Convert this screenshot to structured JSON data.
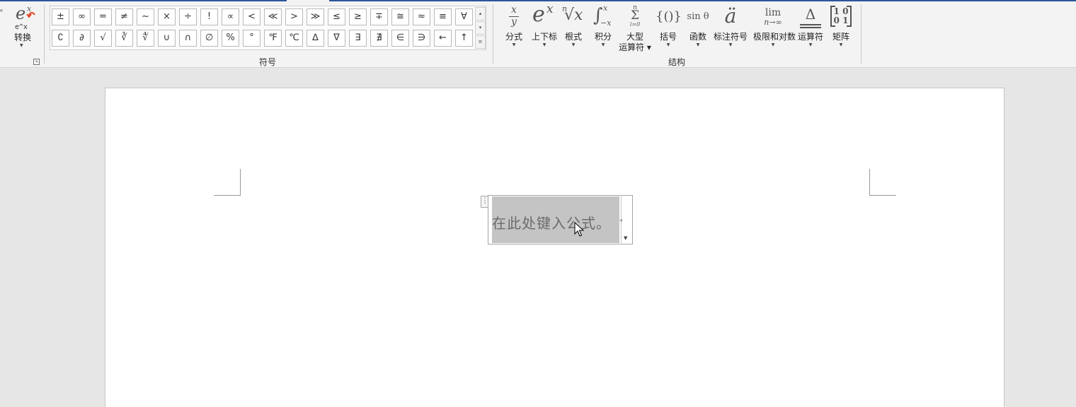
{
  "conversion": {
    "icon_name": "equation-convert-icon",
    "icon_top": "e",
    "icon_sup": "x",
    "icon_sub": "e^x",
    "label": "转换"
  },
  "symbols": {
    "row1": [
      "±",
      "∞",
      "=",
      "≠",
      "~",
      "×",
      "÷",
      "!",
      "∝",
      "<",
      "≪",
      ">",
      "≫",
      "≤",
      "≥",
      "∓",
      "≅",
      "≈",
      "≡",
      "∀"
    ],
    "row2": [
      "∁",
      "∂",
      "√",
      "∛",
      "∜",
      "∪",
      "∩",
      "∅",
      "%",
      "°",
      "℉",
      "℃",
      "∆",
      "∇",
      "∃",
      "∄",
      "∈",
      "∋",
      "←",
      "↑"
    ],
    "label": "符号"
  },
  "structure": {
    "label": "结构",
    "buttons": [
      {
        "name": "fraction",
        "label": "分式"
      },
      {
        "name": "script",
        "label": "上下标"
      },
      {
        "name": "radical",
        "label": "根式"
      },
      {
        "name": "integral",
        "label": "积分"
      },
      {
        "name": "large-operator",
        "label": "大型",
        "label2": "运算符"
      },
      {
        "name": "bracket",
        "label": "括号"
      },
      {
        "name": "function",
        "label": "函数"
      },
      {
        "name": "accent",
        "label": "标注符号"
      },
      {
        "name": "limit-log",
        "label": "极限和对数"
      },
      {
        "name": "operator",
        "label": "运算符"
      },
      {
        "name": "matrix",
        "label": "矩阵"
      }
    ]
  },
  "icons": {
    "fraction": {
      "top": "x",
      "bottom": "y"
    },
    "script": {
      "base": "e",
      "sup": "x"
    },
    "radical": {
      "index": "n",
      "body": "√x"
    },
    "integral": {
      "sym": "∫",
      "sup": "x",
      "sub": "−x"
    },
    "large_operator": {
      "top": "n",
      "sym": "Σ",
      "bottom": "i=0"
    },
    "bracket": {
      "text": "{()}"
    },
    "function": {
      "text": "sin θ"
    },
    "accent": {
      "text": "ä"
    },
    "limit": {
      "top": "lim",
      "bottom": "n→∞"
    },
    "operator": {
      "text": "Δ"
    },
    "matrix": {
      "r1": "1 0",
      "r2": "0 1"
    }
  },
  "equation": {
    "placeholder": "在此处键入公式。"
  },
  "colors": {
    "ribbon": "#f3f3f3",
    "accent": "#2b579a",
    "workspace": "#e6e6e6",
    "field": "#c4c4c4"
  }
}
